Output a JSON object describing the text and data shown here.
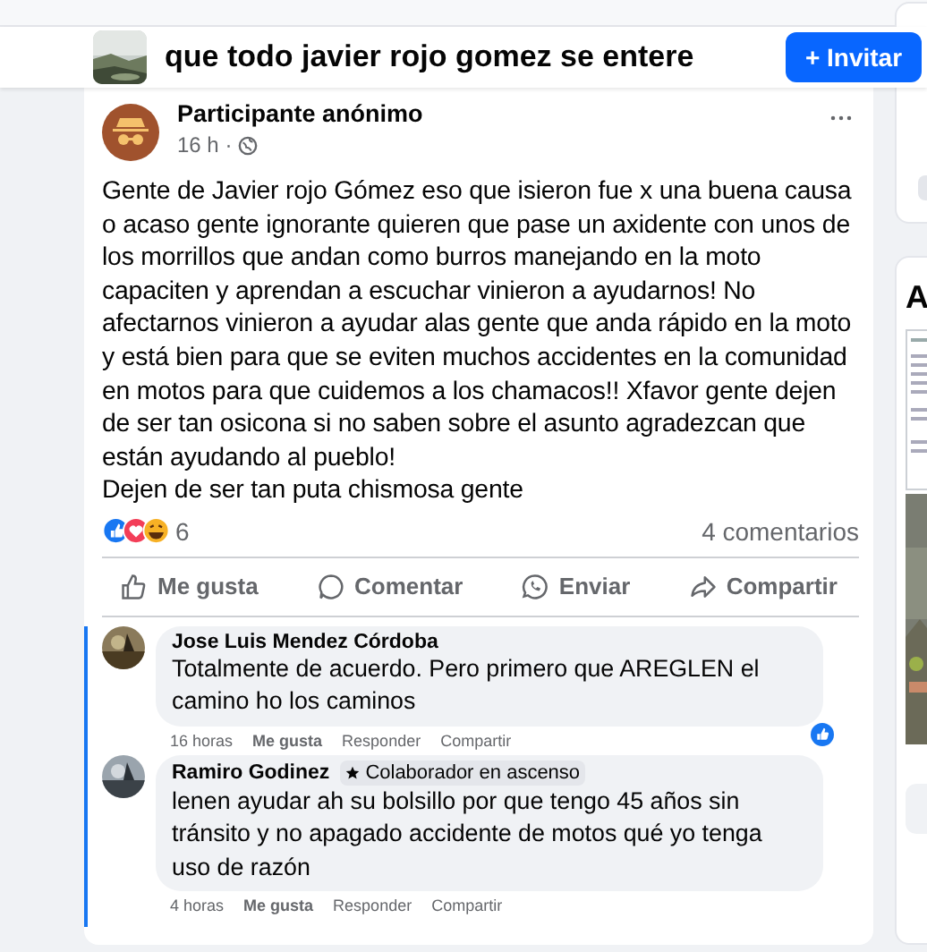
{
  "group": {
    "title": "que todo javier rojo gomez se entere",
    "invite_button": "+ Invitar"
  },
  "post": {
    "author": "Participante anónimo",
    "time": "16 h ·",
    "text": "Gente de Javier rojo Gómez eso que isieron fue x una buena causa o acaso gente ignorante quieren que pase un axidente con unos de los morrillos que andan como burros manejando en la moto capaciten y aprendan a escuchar vinieron a ayudarnos! No afectarnos vinieron a ayudar alas gente que anda rápido en la moto y está bien para que se eviten muchos accidentes en la comunidad en motos para que cuidemos a los chamacos!! Xfavor gente dejen de ser tan osicona si no saben sobre el asunto agradezcan que están ayudando al pueblo!\nDejen de ser tan puta chismosa gente",
    "reaction_count": "6",
    "comment_count": "4 comentarios",
    "actions": [
      {
        "kind": "like",
        "label": "Me gusta"
      },
      {
        "kind": "comment",
        "label": "Comentar"
      },
      {
        "kind": "send",
        "label": "Enviar"
      },
      {
        "kind": "share",
        "label": "Compartir"
      }
    ]
  },
  "comments": [
    {
      "author": "Jose Luis Mendez Córdoba",
      "text": "Totalmente de acuerdo. Pero primero que AREGLEN el camino ho los caminos",
      "time": "16 horas",
      "actions": [
        "Me gusta",
        "Responder",
        "Compartir"
      ],
      "liked": true
    },
    {
      "author": "Ramiro Godinez",
      "badge": "Colaborador en ascenso",
      "text": "lenen ayudar ah su bolsillo por que tengo 45 años sin tránsito y no apagado accidente de motos qué yo tenga uso de razón",
      "time": "4 horas",
      "actions": [
        "Me gusta",
        "Responder",
        "Compartir"
      ],
      "liked": false
    }
  ],
  "side": {
    "heading": "A"
  }
}
